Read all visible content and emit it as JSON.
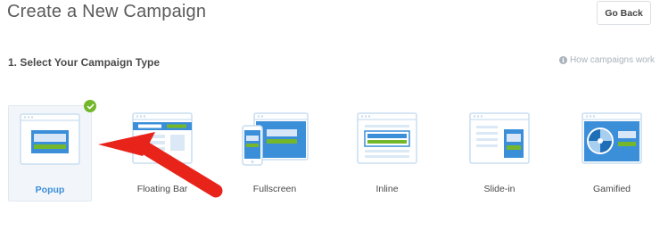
{
  "header": {
    "title": "Create a New Campaign",
    "go_back_label": "Go Back"
  },
  "section": {
    "title": "1. Select Your Campaign Type",
    "help_link": "How campaigns work",
    "help_icon": "info-icon"
  },
  "campaign_types": [
    {
      "label": "Popup",
      "selected": true,
      "icon": "popup-icon"
    },
    {
      "label": "Floating Bar",
      "selected": false,
      "icon": "floating-bar-icon"
    },
    {
      "label": "Fullscreen",
      "selected": false,
      "icon": "fullscreen-icon"
    },
    {
      "label": "Inline",
      "selected": false,
      "icon": "inline-icon"
    },
    {
      "label": "Slide-in",
      "selected": false,
      "icon": "slide-in-icon"
    },
    {
      "label": "Gamified",
      "selected": false,
      "icon": "gamified-icon"
    }
  ],
  "colors": {
    "accent_blue": "#3b8ed8",
    "accent_green": "#74b72b",
    "annotation_red": "#e8231a",
    "outline_light_blue": "#c9ddf0"
  }
}
